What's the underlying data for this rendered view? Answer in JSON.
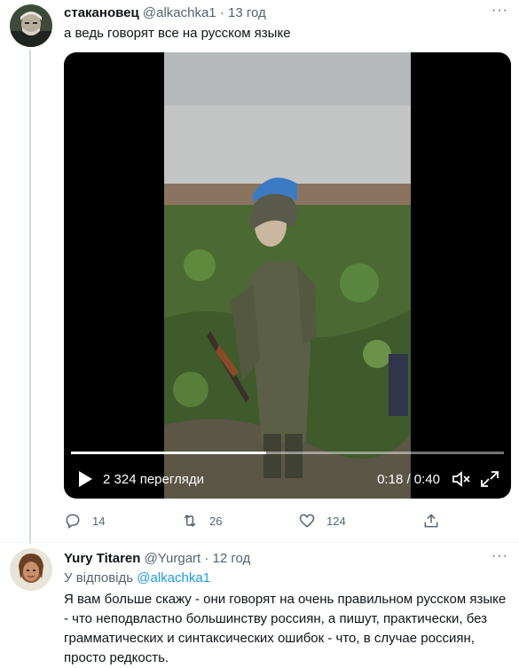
{
  "tweet1": {
    "name": "стакановец",
    "handle": "@alkachka1",
    "dot": "·",
    "time": "13 год",
    "text": "а ведь говорят все на русском языке",
    "video": {
      "views": "2 324 перегляди",
      "timecode": "0:18 / 0:40",
      "progress": 0.45
    },
    "actions": {
      "replies": "14",
      "retweets": "26",
      "likes": "124"
    }
  },
  "tweet2": {
    "name": "Yury Titaren",
    "handle": "@Yurgart",
    "dot": "·",
    "time": "12 год",
    "reply_prefix": "У відповідь",
    "reply_handle": "@alkachka1",
    "text": "Я вам больше скажу - они говорят на очень правильном русском языке - что неподвластно  большинству россиян, а пишут, практически, без грамматических и синтаксических ошибок - что, в случае россиян, просто редкость."
  },
  "more_label": "···",
  "colors": {
    "accent": "#1d9bf0",
    "secondary_text": "#536471",
    "primary_text": "#0f1419"
  },
  "icons": [
    "reply-icon",
    "retweet-icon",
    "like-icon",
    "share-icon",
    "play-icon",
    "mute-icon",
    "fullscreen-icon",
    "more-icon"
  ]
}
